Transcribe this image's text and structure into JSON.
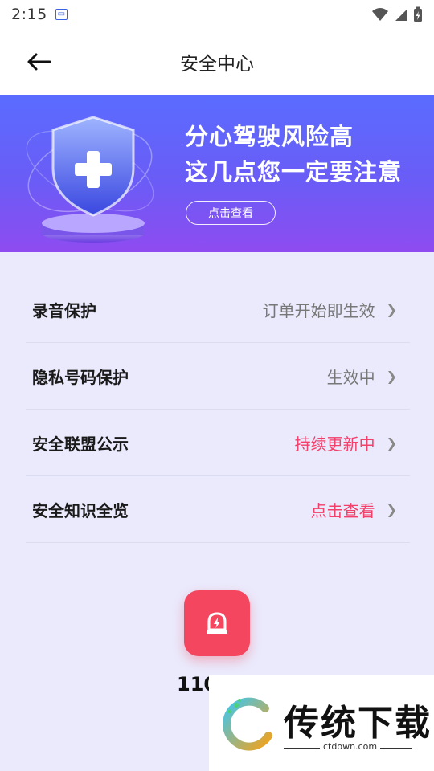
{
  "status_bar": {
    "time": "2:15",
    "notification_icon": "notification-icon"
  },
  "nav": {
    "title": "安全中心",
    "back_icon": "back-arrow-icon"
  },
  "banner": {
    "headline_line1": "分心驾驶风险高",
    "headline_line2": "这几点您一定要注意",
    "cta_label": "点击查看",
    "illustration": "shield-plus-icon"
  },
  "items": [
    {
      "label": "录音保护",
      "value": "订单开始即生效",
      "accent": false
    },
    {
      "label": "隐私号码保护",
      "value": "生效中",
      "accent": false
    },
    {
      "label": "安全联盟公示",
      "value": "持续更新中",
      "accent": true
    },
    {
      "label": "安全知识全览",
      "value": "点击查看",
      "accent": true
    }
  ],
  "emergency": {
    "label": "110",
    "icon": "alarm-siren-icon",
    "color": "#f4475f"
  },
  "watermark": {
    "text": "传统下载",
    "url": "ctdown.com"
  },
  "colors": {
    "accent": "#f2406a",
    "banner_top": "#5a6cff",
    "banner_bottom": "#8f4bf0",
    "background": "#eaeafc"
  }
}
